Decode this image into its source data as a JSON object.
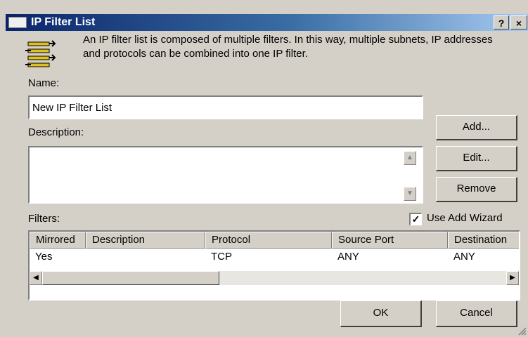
{
  "window": {
    "title": "IP Filter List",
    "help_glyph": "?",
    "close_glyph": "×"
  },
  "info": {
    "icon": "filter-list-icon",
    "text": "An IP filter list is composed of multiple filters. In this way, multiple subnets, IP addresses and protocols can be combined into one IP filter."
  },
  "name": {
    "label": "Name:",
    "value": "New IP Filter List"
  },
  "description": {
    "label": "Description:",
    "value": ""
  },
  "buttons": {
    "add": "Add...",
    "edit": "Edit...",
    "remove": "Remove",
    "ok": "OK",
    "cancel": "Cancel"
  },
  "wizard": {
    "label": "Use Add Wizard",
    "checked": true
  },
  "filters": {
    "label": "Filters:",
    "columns": [
      "Mirrored",
      "Description",
      "Protocol",
      "Source Port",
      "Destination"
    ],
    "rows": [
      {
        "mirrored": "Yes",
        "description": "",
        "protocol": "TCP",
        "source_port": "ANY",
        "destination": "ANY"
      }
    ]
  },
  "colors": {
    "face": "#d4d0c8",
    "titlebar_start": "#0a246a",
    "titlebar_end": "#a6caf0"
  }
}
